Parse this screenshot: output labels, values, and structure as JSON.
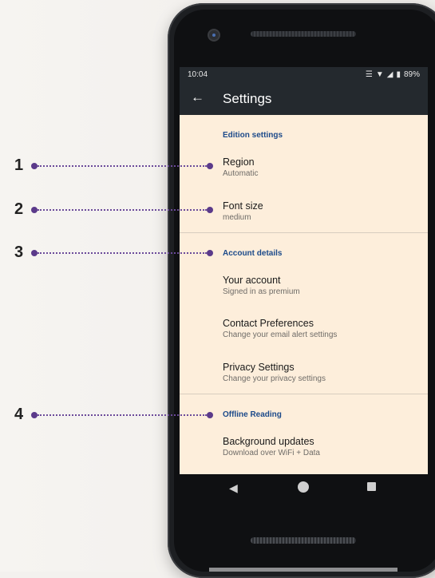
{
  "status": {
    "time": "10:04",
    "battery": "89%"
  },
  "appbar": {
    "title": "Settings"
  },
  "sections": {
    "edition": "Edition settings",
    "account": "Account details",
    "offline": "Offline Reading"
  },
  "items": {
    "region": {
      "title": "Region",
      "subtitle": "Automatic"
    },
    "font_size": {
      "title": "Font size",
      "subtitle": "medium"
    },
    "your_account": {
      "title": "Your account",
      "subtitle": "Signed in as premium"
    },
    "contact": {
      "title": "Contact Preferences",
      "subtitle": "Change your email alert settings"
    },
    "privacy": {
      "title": "Privacy Settings",
      "subtitle": "Change your privacy settings"
    },
    "background": {
      "title": "Background updates",
      "subtitle": "Download over WiFi + Data"
    }
  },
  "callouts": [
    "1",
    "2",
    "3",
    "4"
  ],
  "colors": {
    "screen_bg": "#fdeedb",
    "appbar_bg": "#24292e",
    "section_color": "#1c4a8a",
    "callout_color": "#5b3a8a"
  }
}
